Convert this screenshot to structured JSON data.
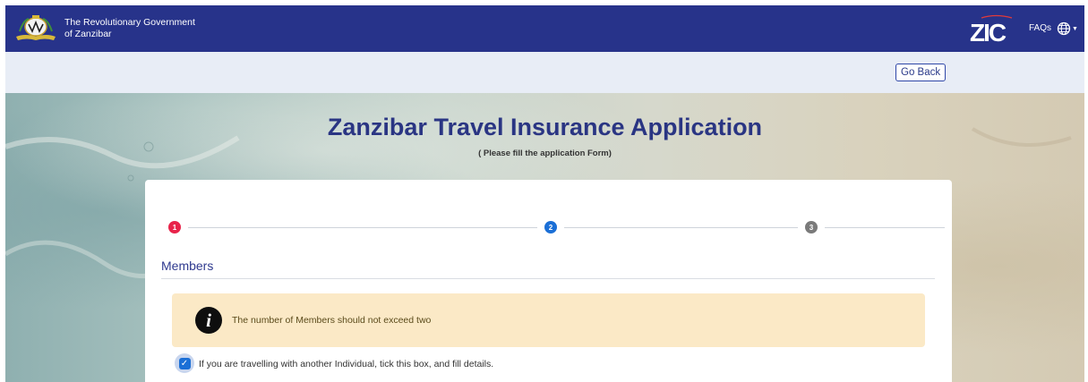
{
  "header": {
    "gov_name_line1": "The Revolutionary Government",
    "gov_name_line2": "of Zanzibar",
    "logo_text": "ZIC",
    "faq_label": "FAQs",
    "background_color": "#27338a"
  },
  "subbar": {
    "go_back_label": "Go Back"
  },
  "hero": {
    "title": "Zanzibar Travel Insurance Application",
    "subtitle": "( Please fill the application Form)"
  },
  "stepper": {
    "steps": [
      {
        "label": "1",
        "color": "#e8234a",
        "state": "error"
      },
      {
        "label": "2",
        "color": "#1b6fd6",
        "state": "active"
      },
      {
        "label": "3",
        "color": "#7a7a7a",
        "state": "pending"
      }
    ]
  },
  "form": {
    "section_title": "Members",
    "alert_text": "The number of Members should not exceed two",
    "companion_checkbox_label": "If you are travelling with another Individual, tick this box, and fill details.",
    "companion_checked": true
  }
}
